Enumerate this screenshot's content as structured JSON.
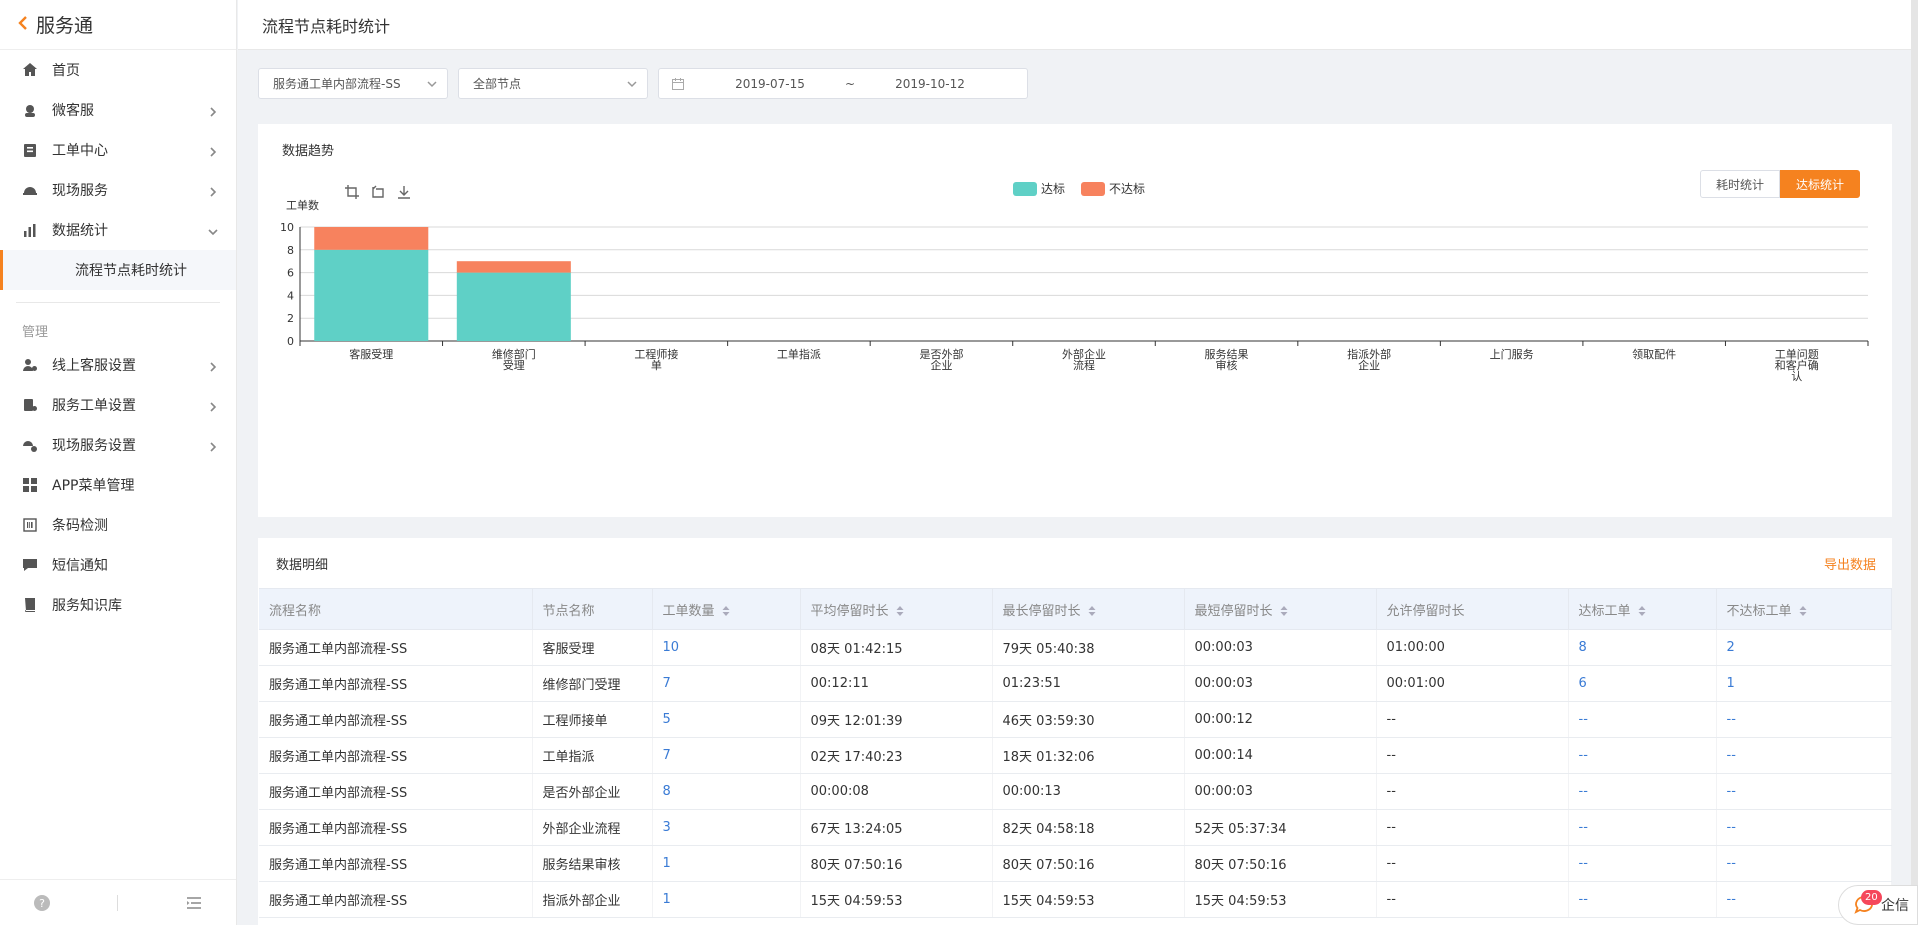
{
  "brand": {
    "back_icon": "chevron-left-icon",
    "name": "服务通"
  },
  "header": {
    "title": "流程节点耗时统计"
  },
  "sidebar": {
    "items": [
      {
        "label": "首页",
        "icon": "home-icon",
        "chevron": ""
      },
      {
        "label": "微客服",
        "icon": "headset-icon",
        "chevron": "right"
      },
      {
        "label": "工单中心",
        "icon": "clipboard-icon",
        "chevron": "right"
      },
      {
        "label": "现场服务",
        "icon": "helmet-icon",
        "chevron": "right"
      },
      {
        "label": "数据统计",
        "icon": "bar-chart-icon",
        "chevron": "down"
      }
    ],
    "sub_item": "流程节点耗时统计",
    "section_label": "管理",
    "manage_items": [
      {
        "label": "线上客服设置",
        "icon": "user-settings-icon",
        "chevron": "right"
      },
      {
        "label": "服务工单设置",
        "icon": "order-settings-icon",
        "chevron": "right"
      },
      {
        "label": "现场服务设置",
        "icon": "field-settings-icon",
        "chevron": "right"
      },
      {
        "label": "APP菜单管理",
        "icon": "grid-icon",
        "chevron": ""
      },
      {
        "label": "条码检测",
        "icon": "barcode-icon",
        "chevron": ""
      },
      {
        "label": "短信通知",
        "icon": "message-icon",
        "chevron": ""
      },
      {
        "label": "服务知识库",
        "icon": "book-icon",
        "chevron": ""
      }
    ]
  },
  "filters": {
    "process": "服务通工单内部流程-SS",
    "node": "全部节点",
    "date_start": "2019-07-15",
    "date_sep": "~",
    "date_end": "2019-10-12"
  },
  "chart_card": {
    "title": "数据趋势",
    "toggle": [
      "耗时统计",
      "达标统计"
    ],
    "active_toggle": "达标统计"
  },
  "chart_data": {
    "type": "bar",
    "stacked": true,
    "ylabel": "工单数",
    "ylim": [
      0,
      10
    ],
    "yticks": [
      0,
      2,
      4,
      6,
      8,
      10
    ],
    "categories": [
      "客服受理",
      "维修部门受理",
      "工程师接单",
      "工单指派",
      "是否外部企业",
      "外部企业流程",
      "服务结果审核",
      "指派外部企业",
      "上门服务",
      "领取配件",
      "工单问题和客户确认"
    ],
    "category_lines": [
      [
        "客服受理"
      ],
      [
        "维修部门",
        "受理"
      ],
      [
        "工程师接",
        "单"
      ],
      [
        "工单指派"
      ],
      [
        "是否外部",
        "企业"
      ],
      [
        "外部企业",
        "流程"
      ],
      [
        "服务结果",
        "审核"
      ],
      [
        "指派外部",
        "企业"
      ],
      [
        "上门服务"
      ],
      [
        "领取配件"
      ],
      [
        "工单问题",
        "和客户确",
        "认"
      ]
    ],
    "series": [
      {
        "name": "达标",
        "color": "#5fd0c6",
        "values": [
          8,
          6,
          0,
          0,
          0,
          0,
          0,
          0,
          0,
          0,
          0
        ]
      },
      {
        "name": "不达标",
        "color": "#f7825e",
        "values": [
          2,
          1,
          0,
          0,
          0,
          0,
          0,
          0,
          0,
          0,
          0
        ]
      }
    ],
    "legend_position": "top",
    "grid": true
  },
  "table": {
    "title": "数据明细",
    "export_label": "导出数据",
    "columns": [
      "流程名称",
      "节点名称",
      "工单数量",
      "平均停留时长",
      "最长停留时长",
      "最短停留时长",
      "允许停留时长",
      "达标工单",
      "不达标工单"
    ],
    "rows": [
      [
        "服务通工单内部流程-SS",
        "客服受理",
        "10",
        "08天 01:42:15",
        "79天 05:40:38",
        "00:00:03",
        "01:00:00",
        "8",
        "2"
      ],
      [
        "服务通工单内部流程-SS",
        "维修部门受理",
        "7",
        "00:12:11",
        "01:23:51",
        "00:00:03",
        "00:01:00",
        "6",
        "1"
      ],
      [
        "服务通工单内部流程-SS",
        "工程师接单",
        "5",
        "09天 12:01:39",
        "46天 03:59:30",
        "00:00:12",
        "--",
        "--",
        "--"
      ],
      [
        "服务通工单内部流程-SS",
        "工单指派",
        "7",
        "02天 17:40:23",
        "18天 01:32:06",
        "00:00:14",
        "--",
        "--",
        "--"
      ],
      [
        "服务通工单内部流程-SS",
        "是否外部企业",
        "8",
        "00:00:08",
        "00:00:13",
        "00:00:03",
        "--",
        "--",
        "--"
      ],
      [
        "服务通工单内部流程-SS",
        "外部企业流程",
        "3",
        "67天 13:24:05",
        "82天 04:58:18",
        "52天 05:37:34",
        "--",
        "--",
        "--"
      ],
      [
        "服务通工单内部流程-SS",
        "服务结果审核",
        "1",
        "80天 07:50:16",
        "80天 07:50:16",
        "80天 07:50:16",
        "--",
        "--",
        "--"
      ],
      [
        "服务通工单内部流程-SS",
        "指派外部企业",
        "1",
        "15天 04:59:53",
        "15天 04:59:53",
        "15天 04:59:53",
        "--",
        "--",
        "--"
      ]
    ]
  },
  "chat": {
    "badge": "20",
    "label": "企信"
  }
}
